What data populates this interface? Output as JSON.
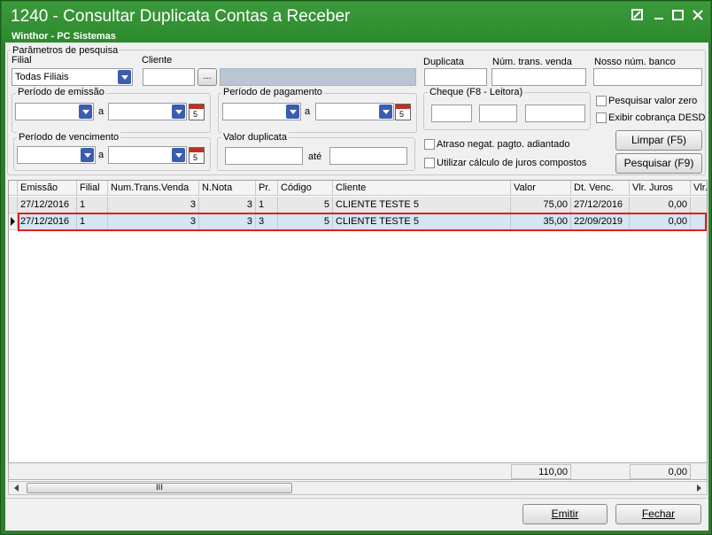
{
  "window": {
    "title": "1240 - Consultar Duplicata Contas a Receber",
    "subtitle": "Winthor - PC Sistemas"
  },
  "params": {
    "group_label": "Parâmetros de pesquisa",
    "filial_label": "Filial",
    "filial_value": "Todas Filiais",
    "cliente_label": "Cliente",
    "cliente_button": "...",
    "duplicata_label": "Duplicata",
    "num_trans_venda_label": "Núm. trans. venda",
    "nosso_num_banco_label": "Nosso núm. banco",
    "periodo_emissao_label": "Período de emissão",
    "periodo_pagamento_label": "Período de pagamento",
    "periodo_vencimento_label": "Período de vencimento",
    "valor_duplicata_label": "Valor duplicata",
    "ate_label": "até",
    "a_label": "a",
    "cheque_label": "Cheque (F8 - Leitora)",
    "pesquisar_valor_zero": "Pesquisar valor zero",
    "exibir_cobranca": "Exibir cobrança  DESD",
    "atraso_negat": "Atraso negat. pagto. adiantado",
    "utilizar_calculo": "Utilizar cálculo de juros compostos",
    "limpar_button": "Limpar (F5)",
    "pesquisar_button": "Pesquisar (F9)",
    "calendar_day": "5"
  },
  "grid": {
    "columns": [
      "Emissão",
      "Filial",
      "Num.Trans.Venda",
      "N.Nota",
      "Pr.",
      "Código",
      "Cliente",
      "Valor",
      "Dt. Venc.",
      "Vlr. Juros",
      "Vlr."
    ],
    "rows": [
      [
        "27/12/2016",
        "1",
        "3",
        "3",
        "1",
        "5",
        "CLIENTE TESTE 5",
        "75,00",
        "27/12/2016",
        "0,00",
        ""
      ],
      [
        "27/12/2016",
        "1",
        "3",
        "3",
        "3",
        "5",
        "CLIENTE TESTE 5",
        "35,00",
        "22/09/2019",
        "0,00",
        ""
      ]
    ],
    "total_valor": "110,00",
    "total_juros": "0,00",
    "scroll_grip": "III"
  },
  "footer": {
    "emitir_button": "Emitir",
    "fechar_button": "Fechar"
  },
  "colors": {
    "titlebar": "#2c8a2c",
    "selected_row_border": "#e02020"
  }
}
